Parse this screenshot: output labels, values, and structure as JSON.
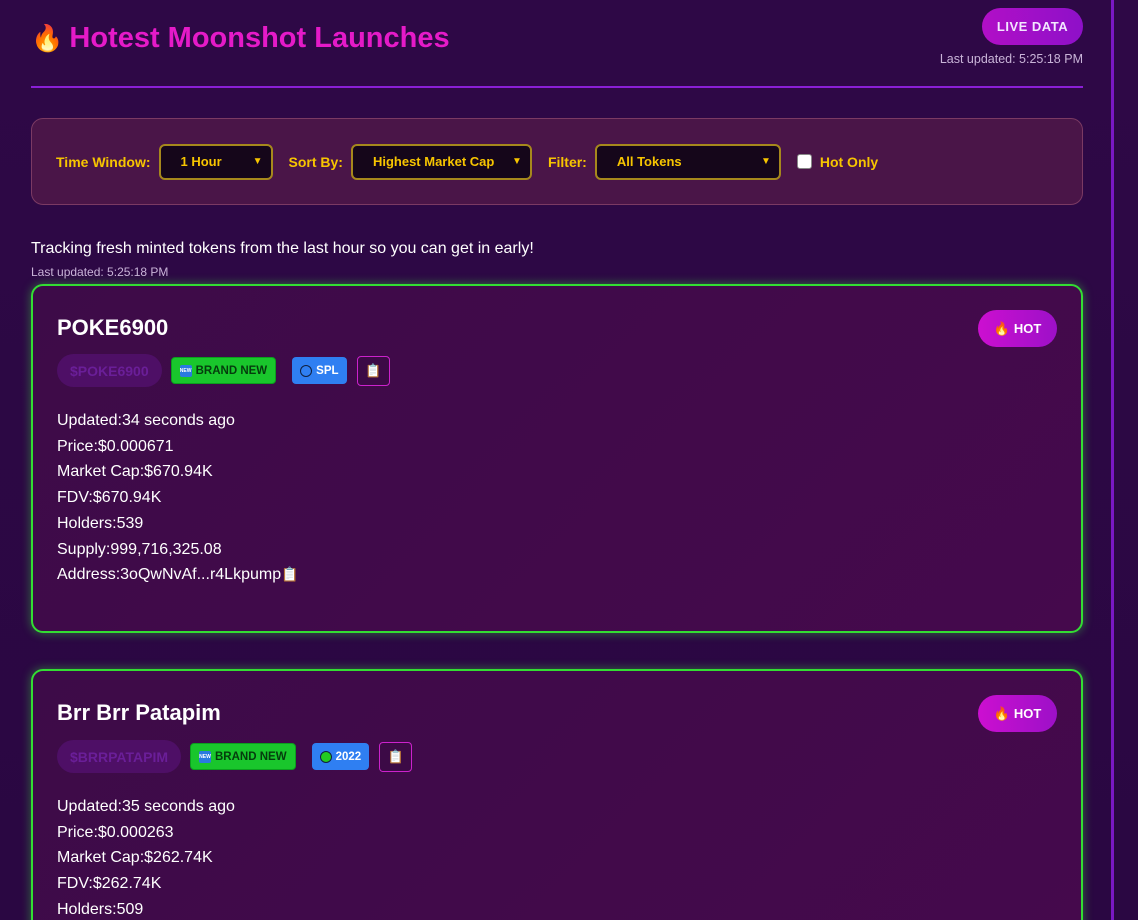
{
  "header": {
    "title": "Hotest Moonshot Launches",
    "title_icon": "fire-icon",
    "live_label": "LIVE DATA",
    "updated": "Last updated: 5:25:18 PM"
  },
  "filters": {
    "time_window_label": "Time Window:",
    "time_window_value": "1 Hour",
    "sort_label": "Sort By:",
    "sort_value": "Highest Market Cap",
    "filter_label": "Filter:",
    "filter_value": "All Tokens",
    "hot_only_label": "Hot Only",
    "hot_only_checked": false
  },
  "info": {
    "tracking": "Tracking fresh minted tokens from the last hour so you can get in early!",
    "updated": "Last updated: 5:25:18 PM"
  },
  "colors": {
    "accent_pink": "#e51ac8",
    "label_yellow": "#f7c500",
    "card_border_green": "#33dd33",
    "brand_new_green": "#19c62c",
    "chain_blue": "#2f7ff2"
  },
  "tokens": [
    {
      "name": "POKE6900",
      "ticker": "$POKE6900",
      "hot_label": "HOT",
      "brand_new_label": "BRAND NEW",
      "chain_label": "SPL",
      "chain_dot_color": "#2f7ff2",
      "details": [
        "Updated:34 seconds ago",
        "Price:$0.000671",
        "Market Cap:$670.94K",
        "FDV:$670.94K",
        "Holders:539",
        "Supply:999,716,325.08",
        "Address:3oQwNvAf...r4Lkpump"
      ]
    },
    {
      "name": "Brr Brr Patapim",
      "ticker": "$BRRPATAPIM",
      "hot_label": "HOT",
      "brand_new_label": "BRAND NEW",
      "chain_label": "2022",
      "chain_dot_color": "#22cc22",
      "details": [
        "Updated:35 seconds ago",
        "Price:$0.000263",
        "Market Cap:$262.74K",
        "FDV:$262.74K",
        "Holders:509"
      ]
    }
  ]
}
